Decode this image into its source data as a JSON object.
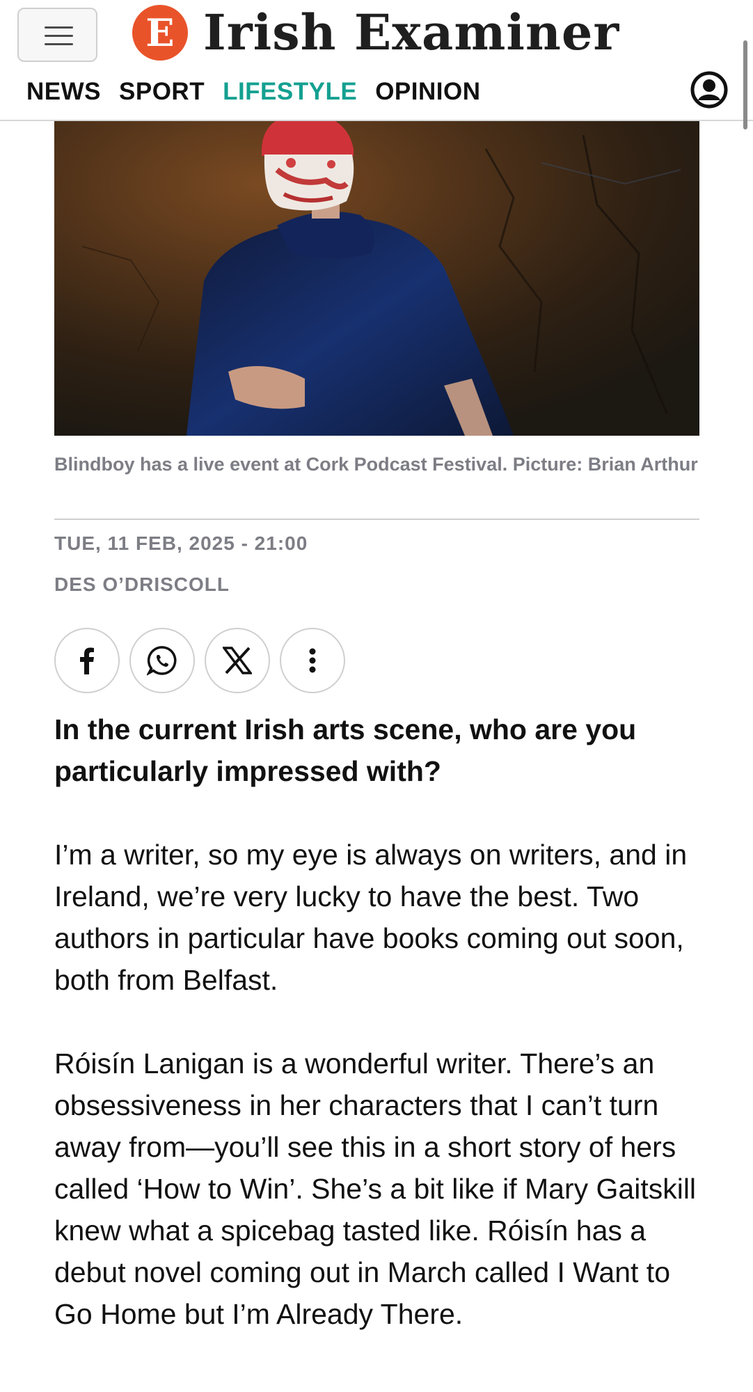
{
  "header": {
    "logo_letter": "E",
    "logo_text": "Irish Examiner",
    "nav": [
      {
        "label": "NEWS"
      },
      {
        "label": "SPORT"
      },
      {
        "label": "LIFESTYLE"
      },
      {
        "label": "OPINION"
      }
    ],
    "active_nav": "LIFESTYLE",
    "accent_color": "#14a090",
    "brand_color": "#e9532a"
  },
  "hero": {
    "caption": "Blindboy has a live event at Cork Podcast Festival. Picture: Brian Arthur"
  },
  "article": {
    "date": "TUE, 11 FEB, 2025 - 21:00",
    "author": "DES O’DRISCOLL",
    "share_icons": [
      "facebook-icon",
      "whatsapp-icon",
      "x-icon",
      "more-vertical-icon"
    ],
    "question": "In the current Irish arts scene, who are you particularly impressed with?",
    "paragraphs": [
      "I’m a writer, so my eye is always on writers, and in Ireland, we’re very lucky to have the best. Two authors in particular have books coming out soon, both from Belfast.",
      "Róisín Lanigan is a wonderful writer. There’s an obsessiveness in her characters that I can’t turn away from—you’ll see this in a short story of hers called ‘How to Win’. She’s a bit like if Mary Gaitskill knew what a spicebag tasted like. Róisín has a debut novel coming out in March called I Want to Go Home but I’m Already There."
    ]
  }
}
